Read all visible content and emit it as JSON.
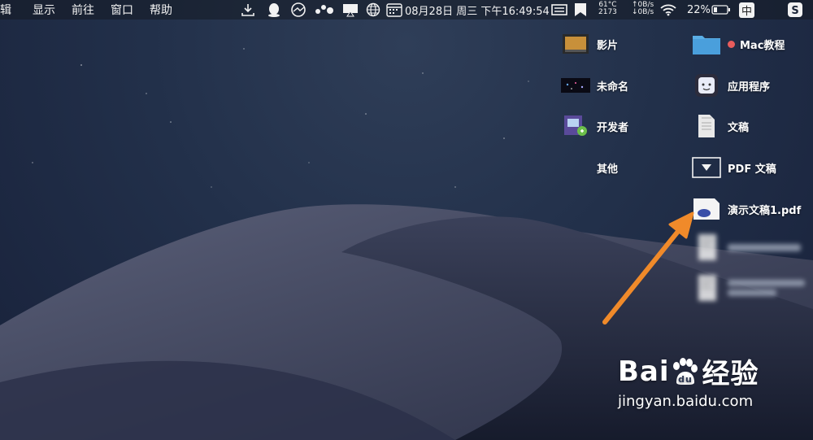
{
  "menu": {
    "items": [
      "辑",
      "显示",
      "前往",
      "窗口",
      "帮助"
    ]
  },
  "status": {
    "temp": "61°C",
    "fan": "2173",
    "net_up": "↑0B/s",
    "net_down": "↓0B/s",
    "datetime": "08月28日 周三 下午16:49:54",
    "battery": "22%",
    "input_method": "中",
    "icons": [
      "download-icon",
      "qq-icon",
      "chart-circle-icon",
      "dots-icon",
      "airplay-icon",
      "globe-icon",
      "calendar-icon",
      "display-icon",
      "app-icon",
      "wifi-icon",
      "battery-icon",
      "sogou-icon"
    ]
  },
  "desktop": {
    "items_left": [
      "影片",
      "未命名",
      "开发者",
      "其他"
    ],
    "items_right": [
      "Mac教程",
      "应用程序",
      "文稿",
      "PDF 文稿",
      "演示文稿1.pdf"
    ],
    "tag_color": "#e85c5c"
  },
  "watermark": {
    "brand": "Bai",
    "brand2": "du",
    "cn": "经验",
    "url": "jingyan.baidu.com"
  },
  "colors": {
    "arrow": "#f08a2a"
  }
}
